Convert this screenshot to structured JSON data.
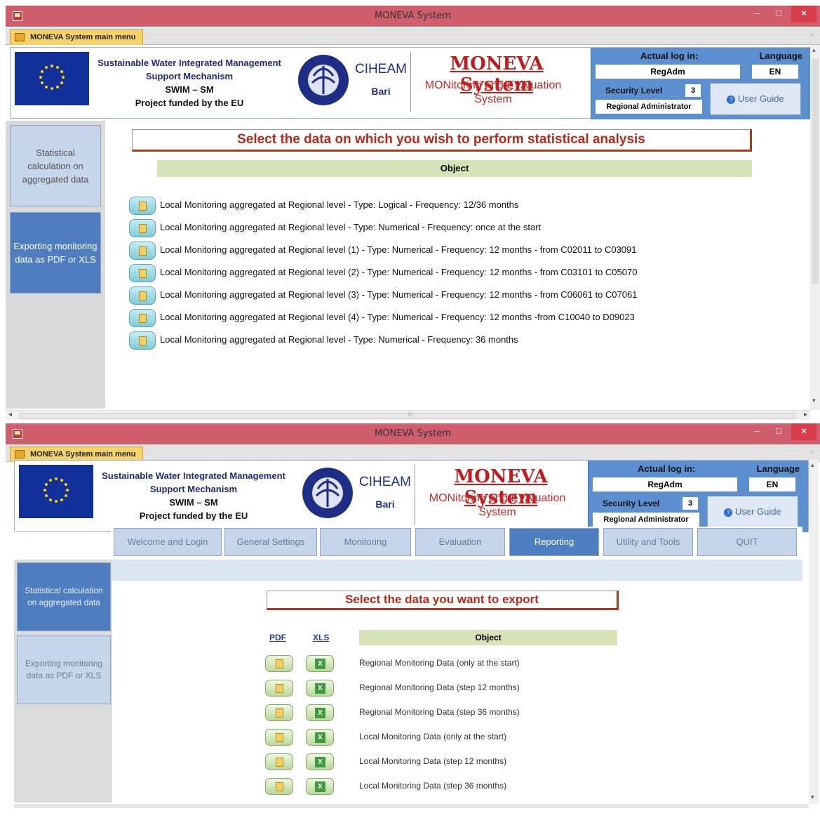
{
  "window1": {
    "title": "MONEVA System",
    "tab_label": "MONEVA System main menu",
    "header": {
      "swim_lines": [
        "Sustainable Water Integrated Management",
        "Support Mechanism",
        "SWIM – SM",
        "Project funded by the EU"
      ],
      "ciheam": "CIHEAM",
      "bari": "Bari",
      "moneva_title": "MONEVA System",
      "moneva_sub_1": "MONitoring and EVAluation",
      "moneva_sub_2": "System"
    },
    "login": {
      "actual_label": "Actual log in:",
      "language_label": "Language",
      "user": "RegAdm",
      "language": "EN",
      "security_label": "Security Level",
      "security_value": "3",
      "role": "Regional Administrator",
      "guide_label": "User Guide"
    },
    "sidebar": [
      {
        "label": "Statistical calculation on aggregated data",
        "active": false
      },
      {
        "label": "Exporting monitoring data as PDF or XLS",
        "active": true
      }
    ],
    "banner": "Select the data on which you wish to perform statistical analysis",
    "object_header": "Object",
    "rows": [
      "Local Monitoring aggregated at Regional level - Type: Logical  -  Frequency: 12/36 months",
      "Local Monitoring aggregated at Regional level - Type: Numerical  - Frequency: once at the start",
      "Local Monitoring aggregated at Regional level (1) - Type: Numerical  - Frequency: 12 months - from C02011 to C03091",
      "Local Monitoring aggregated at Regional level (2) - Type: Numerical  - Frequency: 12 months - from C03101 to C05070",
      "Local Monitoring aggregated at Regional level (3) - Type: Numerical  - Frequency: 12 months - from C06061 to C07061",
      "Local Monitoring aggregated at Regional level (4) - Type: Numerical  - Frequency: 12 months -from C10040 to D09023",
      "Local Monitoring aggregated at Regional level - Type: Numerical  - Frequency: 36 months"
    ],
    "scroll_mid": "III"
  },
  "window2": {
    "title": "MONEVA System",
    "tab_label": "MONEVA System main menu",
    "header": {
      "swim_lines": [
        "Sustainable Water Integrated Management",
        "Support Mechanism",
        "SWIM – SM",
        "Project funded by the EU"
      ],
      "ciheam": "CIHEAM",
      "bari": "Bari",
      "moneva_title": "MONEVA System",
      "moneva_sub_1": "MONitoring and EVAluation",
      "moneva_sub_2": "System"
    },
    "login": {
      "actual_label": "Actual log in:",
      "language_label": "Language",
      "user": "RegAdm",
      "language": "EN",
      "security_label": "Security Level",
      "security_value": "3",
      "role": "Regional Administrator",
      "guide_label": "User Guide"
    },
    "nav": [
      "Welcome and Login",
      "General Settings",
      "Monitoring",
      "Evaluation",
      "Reporting",
      "Utility and Tools",
      "QUIT"
    ],
    "nav_active": "Reporting",
    "sidebar": [
      {
        "label": "Statistical calculation on aggregated data",
        "active": true
      },
      {
        "label": "Exporting monitoring data as PDF or XLS",
        "active": false
      }
    ],
    "banner": "Select the data you want to export",
    "pdf_label": "PDF",
    "xls_label": "XLS",
    "object_header": "Object",
    "rows": [
      "Regional Monitoring Data (only at the start)",
      "Regional Monitoring Data (step 12 months)",
      "Regional Monitoring Data (step 36 months)",
      "Local Monitoring Data (only at the start)",
      "Local Monitoring Data (step 12 months)",
      "Local Monitoring Data (step 36 months)"
    ]
  },
  "colors": {
    "titlebar": "#d15e6c",
    "accent_blue": "#4f7ec0",
    "banner_red": "#b82a1a",
    "object_header_green": "#d6e4b8"
  }
}
